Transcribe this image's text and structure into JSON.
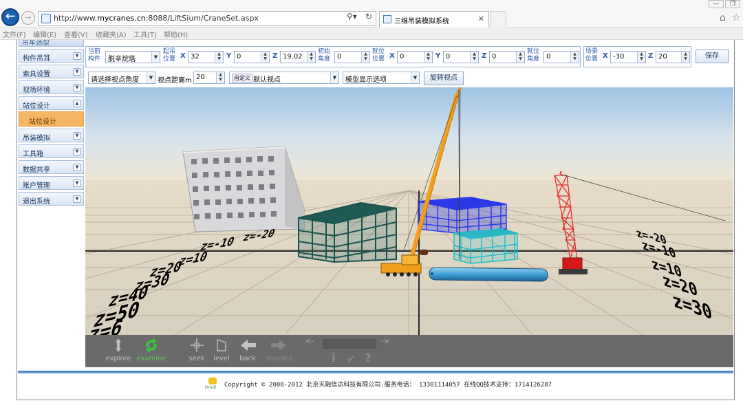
{
  "browser": {
    "url_prefix": "http://www.",
    "url_host": "mycranes.cn",
    "url_rest": ":8088/LiftSium/CraneSet.aspx",
    "tab_title": "三维吊装模拟系统",
    "menu": [
      "文件(F)",
      "编辑(E)",
      "查看(V)",
      "收藏夹(A)",
      "工具(T)",
      "帮助(H)"
    ]
  },
  "sidebar": {
    "top_partial": "吊车选型",
    "items_top": [
      "构件吊耳",
      "索具设置",
      "现场环境",
      "站位设计"
    ],
    "sub_item": "站位设计",
    "items_bottom": [
      "吊装模拟",
      "工具箱",
      "数据共享",
      "账户管理",
      "退出系统"
    ]
  },
  "toolbar": {
    "current_part_label": "当前\n构件",
    "current_part_value": "脱辛烷塔",
    "lift_pos_label": "起吊\n位置",
    "x_label": "X",
    "y_label": "Y",
    "z_label": "Z",
    "lift_x": "32",
    "lift_y": "0",
    "lift_z": "19.02",
    "init_angle_label": "初始\n角度",
    "init_angle": "0",
    "place_pos_label": "就位\n位置",
    "place_x": "0",
    "place_y": "0",
    "place_z": "0",
    "place_angle_label": "就位\n角度",
    "place_angle": "0",
    "scene_pos_label": "场景\n位置",
    "scene_x": "-30",
    "scene_z": "20",
    "save_label": "保存",
    "view_angle_select": "请选择视点角度",
    "view_distance_label": "视点距离m",
    "view_distance": "20",
    "custom_badge": "自定义",
    "custom_view_value": "默认视点",
    "model_display_select": "模型显示选项",
    "rotate_view_label": "旋转视点"
  },
  "viewer": {
    "tools": [
      {
        "label": "explore",
        "icon": "explore-icon"
      },
      {
        "label": "examine",
        "icon": "examine-icon"
      },
      {
        "label": "seek",
        "icon": "seek-icon"
      },
      {
        "label": "level",
        "icon": "level-icon"
      },
      {
        "label": "back",
        "icon": "back-arrow-icon"
      },
      {
        "label": "forward",
        "icon": "forward-arrow-icon"
      }
    ],
    "prev_arrow": "<-",
    "next_arrow": "->",
    "info_glyph": "i",
    "check_glyph": "✔",
    "help_glyph": "?",
    "grid_labels_left": [
      "z=-20",
      "z=-10",
      "z=10",
      "z=20",
      "z=30",
      "z=40",
      "z=50",
      "z=6"
    ],
    "grid_labels_right": [
      "z=-20",
      "z=-10",
      "z=10",
      "z=20",
      "z=30"
    ],
    "accent_colors": {
      "crane": "#f0a01c",
      "crawler": "#d21a1a",
      "steel_teal": "#1f6f6a",
      "steel_blue": "#2030e0",
      "vessel": "#4fb0e0"
    }
  },
  "footer": {
    "copyright": "Copyright © 2008-2012 北京天融信达科技有限公司.服务电话： 13301114057 在线QQ技术支持：1714126287",
    "logo_text": "trmdi"
  }
}
